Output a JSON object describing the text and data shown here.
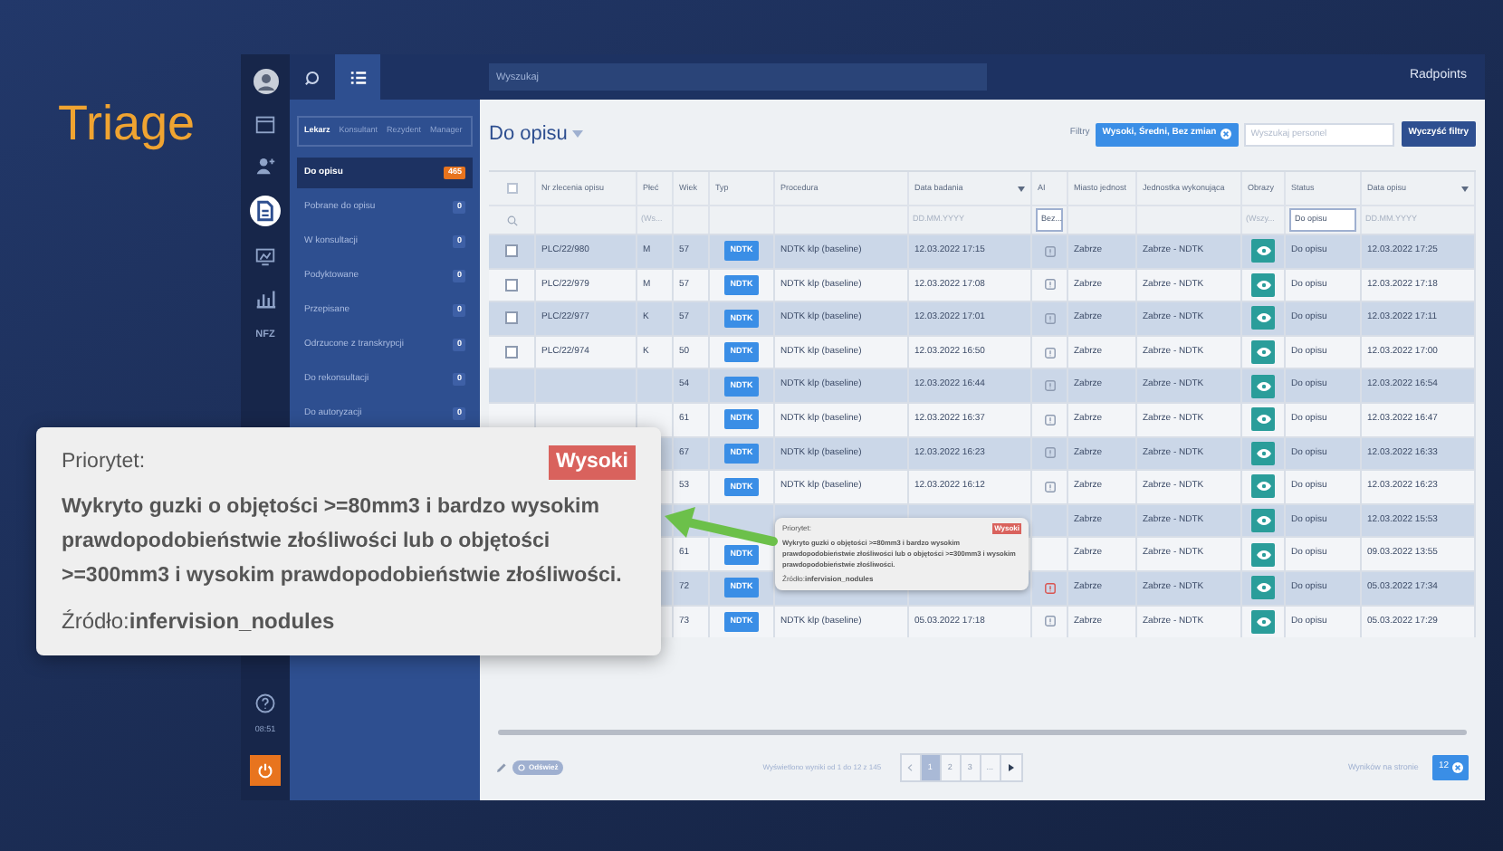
{
  "slide_title": "Triage",
  "rail": {
    "items": [
      {
        "kind": "calendar",
        "selected": false
      },
      {
        "kind": "person",
        "selected": false
      },
      {
        "kind": "record",
        "selected": true
      },
      {
        "kind": "monitor",
        "selected": false
      },
      {
        "kind": "chart",
        "selected": false
      }
    ],
    "label": "NFZ",
    "time": "08:51"
  },
  "topbar": {
    "tabs": [
      {
        "kind": "search",
        "selected": false
      },
      {
        "kind": "list",
        "selected": true
      }
    ],
    "search": {
      "placeholder": "Wyszukaj"
    },
    "logo": "Radpoints"
  },
  "sidebar": {
    "tabs": [
      {
        "label": "Lekarz",
        "selected": true
      },
      {
        "label": "Konsultant",
        "selected": false
      },
      {
        "label": "Rezydent",
        "selected": false
      },
      {
        "label": "Manager",
        "selected": false
      }
    ],
    "items": [
      {
        "label": "Do opisu",
        "count": "465",
        "selected": true
      },
      {
        "label": "Pobrane do opisu",
        "count": "0",
        "selected": false
      },
      {
        "label": "W konsultacji",
        "count": "0",
        "selected": false
      },
      {
        "label": "Podyktowane",
        "count": "0",
        "selected": false
      },
      {
        "label": "Przepisane",
        "count": "0",
        "selected": false
      },
      {
        "label": "Odrzucone z transkrypcji",
        "count": "0",
        "selected": false
      },
      {
        "label": "Do rekonsultacji",
        "count": "0",
        "selected": false
      },
      {
        "label": "Do autoryzacji",
        "count": "0",
        "selected": false
      }
    ]
  },
  "main": {
    "title": "Do opisu",
    "filters_label": "Filtry",
    "filter_chip": "Wysoki, Średni, Bez zmian",
    "staff_search": {
      "placeholder": "Wyszukaj personel"
    },
    "clear_button": "Wyczyść filtry"
  },
  "table": {
    "columns": [
      {
        "kind": "checkbox",
        "checked": false,
        "filter": {
          "kind": "search"
        }
      },
      {
        "kind": "text",
        "label": "Nr zlecenia opisu"
      },
      {
        "kind": "text",
        "label": "Płeć",
        "filter": {
          "kind": "text",
          "text": "(Ws..."
        }
      },
      {
        "kind": "text",
        "label": "Wiek"
      },
      {
        "kind": "text",
        "label": "Typ"
      },
      {
        "kind": "text",
        "label": "Procedura"
      },
      {
        "kind": "text",
        "label": "Data badania",
        "sortable": true,
        "filter": {
          "kind": "text",
          "text": "DD.MM.YYYY"
        }
      },
      {
        "kind": "text",
        "label": "AI",
        "filter": {
          "kind": "field",
          "text": "Bez..."
        }
      },
      {
        "kind": "text",
        "label": "Miasto jednost"
      },
      {
        "kind": "text",
        "label": "Jednostka wykonująca"
      },
      {
        "kind": "text",
        "label": "Obrazy",
        "filter": {
          "kind": "text",
          "text": "(Wszy..."
        }
      },
      {
        "kind": "text",
        "label": "Status",
        "filter": {
          "kind": "field",
          "text": "Do opisu"
        }
      },
      {
        "kind": "text",
        "label": "Data opisu",
        "sortable": true,
        "filter": {
          "kind": "text",
          "text": "DD.MM.YYYY"
        }
      }
    ],
    "rows": [
      {
        "checked": false,
        "id": "PLC/22/980",
        "sex": "M",
        "age": "57",
        "type": "NDTK",
        "procedure": "NDTK klp (baseline)",
        "exam_date": "12.03.2022 17:15",
        "ai_alert": false,
        "city": "Zabrze",
        "unit": "Zabrze - NDTK",
        "status": "Do opisu",
        "report_date": "12.03.2022 17:25"
      },
      {
        "checked": false,
        "id": "PLC/22/979",
        "sex": "M",
        "age": "57",
        "type": "NDTK",
        "procedure": "NDTK klp (baseline)",
        "exam_date": "12.03.2022 17:08",
        "ai_alert": false,
        "city": "Zabrze",
        "unit": "Zabrze - NDTK",
        "status": "Do opisu",
        "report_date": "12.03.2022 17:18"
      },
      {
        "checked": false,
        "id": "PLC/22/977",
        "sex": "K",
        "age": "57",
        "type": "NDTK",
        "procedure": "NDTK klp (baseline)",
        "exam_date": "12.03.2022 17:01",
        "ai_alert": false,
        "city": "Zabrze",
        "unit": "Zabrze - NDTK",
        "status": "Do opisu",
        "report_date": "12.03.2022 17:11"
      },
      {
        "checked": false,
        "id": "PLC/22/974",
        "sex": "K",
        "age": "50",
        "type": "NDTK",
        "procedure": "NDTK klp (baseline)",
        "exam_date": "12.03.2022 16:50",
        "ai_alert": false,
        "city": "Zabrze",
        "unit": "Zabrze - NDTK",
        "status": "Do opisu",
        "report_date": "12.03.2022 17:00"
      },
      {
        "age": "54",
        "type": "NDTK",
        "procedure": "NDTK klp (baseline)",
        "exam_date": "12.03.2022 16:44",
        "ai_alert": false,
        "city": "Zabrze",
        "unit": "Zabrze - NDTK",
        "status": "Do opisu",
        "report_date": "12.03.2022 16:54"
      },
      {
        "age": "61",
        "type": "NDTK",
        "procedure": "NDTK klp (baseline)",
        "exam_date": "12.03.2022 16:37",
        "ai_alert": false,
        "city": "Zabrze",
        "unit": "Zabrze - NDTK",
        "status": "Do opisu",
        "report_date": "12.03.2022 16:47"
      },
      {
        "age": "67",
        "type": "NDTK",
        "procedure": "NDTK klp (baseline)",
        "exam_date": "12.03.2022 16:23",
        "ai_alert": false,
        "city": "Zabrze",
        "unit": "Zabrze - NDTK",
        "status": "Do opisu",
        "report_date": "12.03.2022 16:33"
      },
      {
        "age": "53",
        "type": "NDTK",
        "procedure": "NDTK klp (baseline)",
        "exam_date": "12.03.2022 16:12",
        "ai_alert": false,
        "city": "Zabrze",
        "unit": "Zabrze - NDTK",
        "status": "Do opisu",
        "report_date": "12.03.2022 16:23"
      },
      {
        "city": "Zabrze",
        "unit": "Zabrze - NDTK",
        "status": "Do opisu",
        "report_date": "12.03.2022 15:53"
      },
      {
        "age": "61",
        "type": "NDTK",
        "city": "Zabrze",
        "unit": "Zabrze - NDTK",
        "status": "Do opisu",
        "report_date": "09.03.2022 13:55"
      },
      {
        "age": "72",
        "type": "NDTK",
        "ai_alert": true,
        "city": "Zabrze",
        "unit": "Zabrze - NDTK",
        "status": "Do opisu",
        "report_date": "05.03.2022 17:34"
      },
      {
        "age": "73",
        "type": "NDTK",
        "procedure": "NDTK klp (baseline)",
        "exam_date": "05.03.2022 17:18",
        "ai_alert": false,
        "city": "Zabrze",
        "unit": "Zabrze - NDTK",
        "status": "Do opisu",
        "report_date": "05.03.2022 17:29"
      }
    ]
  },
  "footer": {
    "refresh": "Odśwież",
    "summary": "Wyświetlono wyniki od 1 do 12 z 145",
    "pages": [
      {
        "label": "1",
        "selected": true
      },
      {
        "label": "2",
        "selected": false
      },
      {
        "label": "3",
        "selected": false
      },
      {
        "label": "...",
        "selected": false
      }
    ],
    "per_page_label": "Wyników na stronie",
    "per_page": "12"
  },
  "tooltip": {
    "label": "Priorytet:",
    "priority": "Wysoki",
    "description": "Wykryto guzki o objętości >=80mm3 i bardzo wysokim prawdopodobieństwie złośliwości lub o objętości >=300mm3 i wysokim prawdopodobieństwie złośliwości.",
    "source": "Źródło:**infervision_nodules**"
  },
  "popup": {
    "label": "Priorytet:",
    "priority": "Wysoki",
    "description": "Wykryto guzki o objętości >=80mm3 i bardzo wysokim prawdopodobieństwie złośliwości lub o objętości >=300mm3 i wysokim prawdopodobieństwie złośliwości.",
    "source": "Źródło:**infervision_nodules**"
  }
}
